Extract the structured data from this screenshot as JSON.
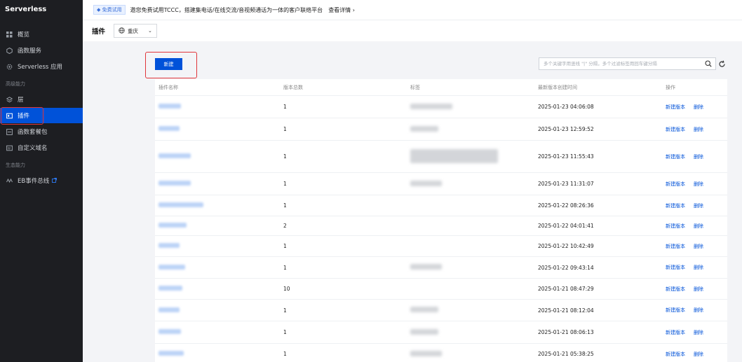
{
  "sidebar": {
    "title": "Serverless",
    "items": [
      {
        "label": "概览",
        "icon": "grid-icon"
      },
      {
        "label": "函数服务",
        "icon": "function-icon"
      },
      {
        "label": "Serverless 应用",
        "icon": "gear-icon"
      }
    ],
    "section_advanced": "高级能力",
    "advanced_items": [
      {
        "label": "层",
        "icon": "layers-icon"
      },
      {
        "label": "插件",
        "icon": "plugin-icon"
      },
      {
        "label": "函数套餐包",
        "icon": "package-icon"
      },
      {
        "label": "自定义域名",
        "icon": "domain-icon"
      }
    ],
    "section_ecosystem": "生态能力",
    "ecosystem_items": [
      {
        "label": "EB事件总线",
        "icon": "eventbus-icon"
      }
    ]
  },
  "promo": {
    "tag": "免费试用",
    "text": "邀您免费试用TCCC，搭建集电话/在线交流/音视频通话为一体的客户联络平台",
    "link": "查看详情 ›"
  },
  "header": {
    "title": "插件",
    "region": "重庆"
  },
  "toolbar": {
    "new_label": "新建",
    "search_placeholder": "多个关键字用竖线 \"|\" 分隔，多个过滤标签用回车键分隔"
  },
  "table": {
    "columns": [
      "插件名称",
      "版本总数",
      "标签",
      "最新版本创建时间",
      "操作"
    ],
    "actions": {
      "new_version": "新建版本",
      "delete": "删除"
    },
    "rows": [
      {
        "versions": "1",
        "created": "2025-01-23 04:06:08"
      },
      {
        "versions": "1",
        "created": "2025-01-23 12:59:52"
      },
      {
        "versions": "1",
        "created": "2025-01-23 11:55:43"
      },
      {
        "versions": "1",
        "created": "2025-01-23 11:31:07"
      },
      {
        "versions": "1",
        "created": "2025-01-22 08:26:36"
      },
      {
        "versions": "2",
        "created": "2025-01-22 04:01:41"
      },
      {
        "versions": "1",
        "created": "2025-01-22 10:42:49"
      },
      {
        "versions": "1",
        "created": "2025-01-22 09:43:14"
      },
      {
        "versions": "10",
        "created": "2025-01-21 08:47:29"
      },
      {
        "versions": "1",
        "created": "2025-01-21 08:12:04"
      },
      {
        "versions": "1",
        "created": "2025-01-21 08:06:13"
      },
      {
        "versions": "1",
        "created": "2025-01-21 05:38:25"
      }
    ]
  },
  "colors": {
    "accent": "#0052d9",
    "sidebar_bg": "#1d1e22",
    "highlight": "#e0353a"
  }
}
